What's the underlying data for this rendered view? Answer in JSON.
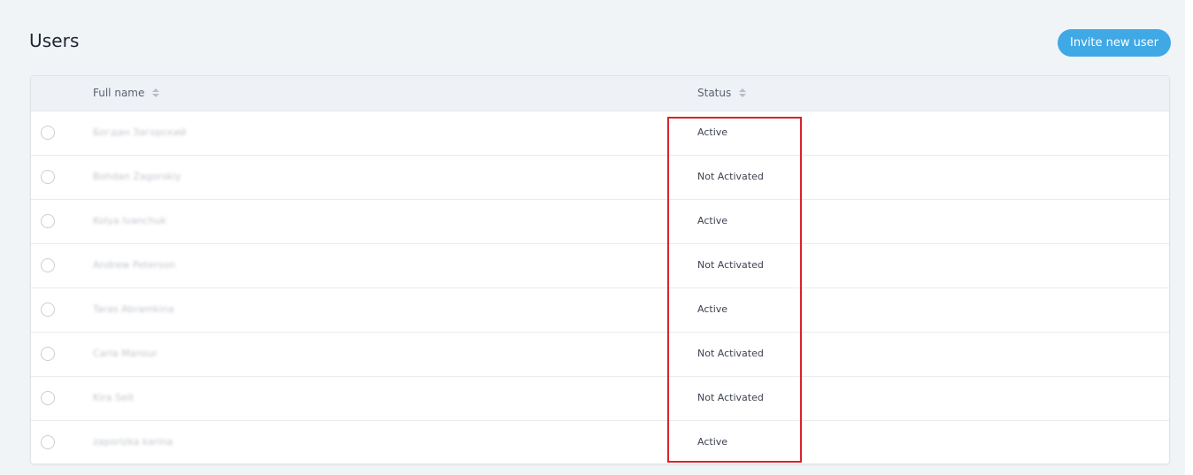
{
  "page": {
    "title": "Users",
    "invite_button": "Invite new user"
  },
  "table": {
    "columns": {
      "full_name": "Full name",
      "status": "Status"
    },
    "rows": [
      {
        "name": "Богдан Загорский",
        "status": "Active"
      },
      {
        "name": "Bohdan Zagorskiy",
        "status": "Not Activated"
      },
      {
        "name": "Kolya Ivanchuk",
        "status": "Active"
      },
      {
        "name": "Andrew Peterson",
        "status": "Not Activated"
      },
      {
        "name": "Taras Abramkina",
        "status": "Active"
      },
      {
        "name": "Carla Mansur",
        "status": "Not Activated"
      },
      {
        "name": "Kira Seit",
        "status": "Not Activated"
      },
      {
        "name": "zaporizka karina",
        "status": "Active"
      }
    ]
  },
  "colors": {
    "accent": "#3fa9e6",
    "highlight": "#d8232a",
    "background": "#f1f4f7"
  }
}
